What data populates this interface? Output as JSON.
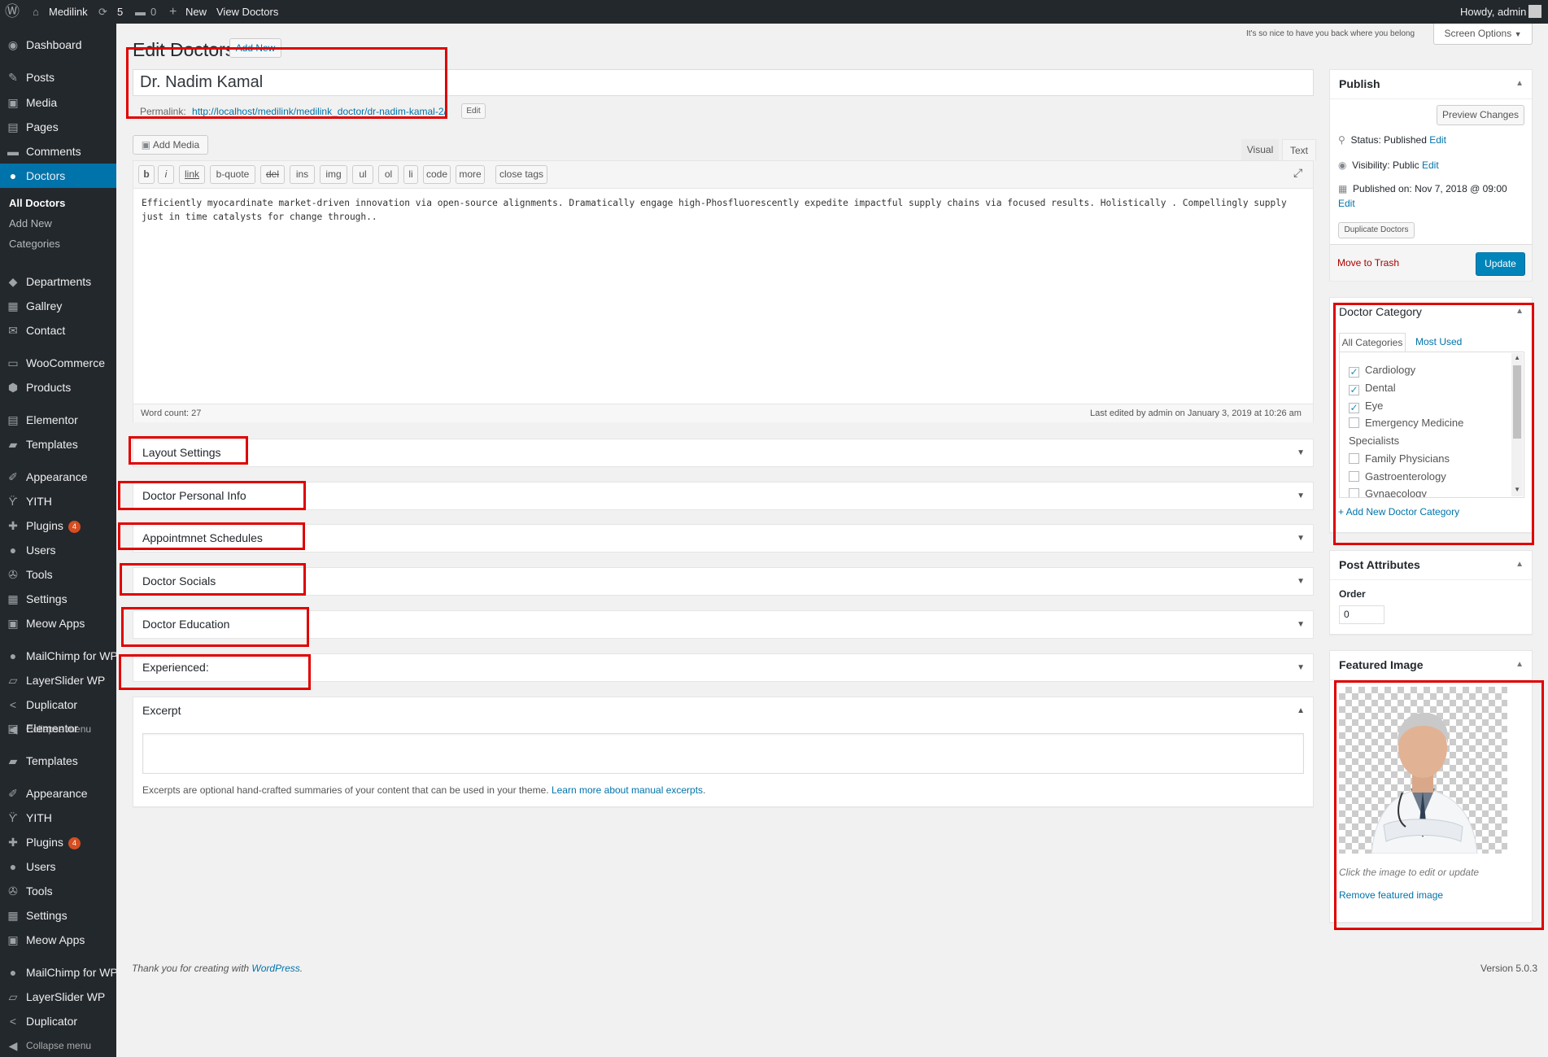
{
  "adminbar": {
    "site_name": "Medilink",
    "updates_count": "5",
    "comments_count": "0",
    "new_label": "New",
    "view_label": "View Doctors",
    "howdy": "Howdy, admin"
  },
  "sidebar": {
    "items": [
      {
        "label": "Dashboard",
        "icon": "dashboard-icon",
        "glyph": "◉"
      },
      {
        "label": "Posts",
        "icon": "pin-icon",
        "glyph": "✎"
      },
      {
        "label": "Media",
        "icon": "media-icon",
        "glyph": "▣"
      },
      {
        "label": "Pages",
        "icon": "page-icon",
        "glyph": "▤"
      },
      {
        "label": "Comments",
        "icon": "comment-icon",
        "glyph": "▬"
      },
      {
        "label": "Doctors",
        "icon": "user-icon",
        "glyph": "●"
      },
      {
        "label": "Departments",
        "icon": "tag-icon",
        "glyph": "◆"
      },
      {
        "label": "Gallrey",
        "icon": "gallery-icon",
        "glyph": "▦"
      },
      {
        "label": "Contact",
        "icon": "mail-icon",
        "glyph": "✉"
      },
      {
        "label": "WooCommerce",
        "icon": "woo-icon",
        "glyph": "▭"
      },
      {
        "label": "Products",
        "icon": "box-icon",
        "glyph": "⬢"
      },
      {
        "label": "Elementor",
        "icon": "elementor-icon",
        "glyph": "▤"
      },
      {
        "label": "Templates",
        "icon": "folder-icon",
        "glyph": "▰"
      },
      {
        "label": "Appearance",
        "icon": "brush-icon",
        "glyph": "✐"
      },
      {
        "label": "YITH",
        "icon": "yith-icon",
        "glyph": "ϔ"
      },
      {
        "label": "Plugins",
        "icon": "plugin-icon",
        "glyph": "✚",
        "badge": "4"
      },
      {
        "label": "Users",
        "icon": "users-icon",
        "glyph": "●"
      },
      {
        "label": "Tools",
        "icon": "wrench-icon",
        "glyph": "✇"
      },
      {
        "label": "Settings",
        "icon": "settings-icon",
        "glyph": "▦"
      },
      {
        "label": "Meow Apps",
        "icon": "camera-icon",
        "glyph": "▣"
      },
      {
        "label": "MailChimp for WP",
        "icon": "mailchimp-icon",
        "glyph": "●"
      },
      {
        "label": "LayerSlider WP",
        "icon": "layers-icon",
        "glyph": "▱"
      },
      {
        "label": "Duplicator",
        "icon": "share-icon",
        "glyph": "<"
      },
      {
        "label": "Collapse menu",
        "icon": "collapse-icon",
        "glyph": "◀"
      }
    ],
    "dup_items": [
      {
        "label": "Elementor",
        "icon": "elementor-icon",
        "glyph": "▤"
      },
      {
        "label": "Templates",
        "icon": "folder-icon",
        "glyph": "▰"
      },
      {
        "label": "Appearance",
        "icon": "brush-icon",
        "glyph": "✐"
      },
      {
        "label": "YITH",
        "icon": "yith-icon",
        "glyph": "ϔ"
      },
      {
        "label": "Plugins",
        "icon": "plugin-icon",
        "glyph": "✚",
        "badge": "4"
      },
      {
        "label": "Users",
        "icon": "users-icon",
        "glyph": "●"
      },
      {
        "label": "Tools",
        "icon": "wrench-icon",
        "glyph": "✇"
      },
      {
        "label": "Settings",
        "icon": "settings-icon",
        "glyph": "▦"
      },
      {
        "label": "Meow Apps",
        "icon": "camera-icon",
        "glyph": "▣"
      },
      {
        "label": "MailChimp for WP",
        "icon": "mailchimp-icon",
        "glyph": "●"
      },
      {
        "label": "LayerSlider WP",
        "icon": "layers-icon",
        "glyph": "▱"
      },
      {
        "label": "Duplicator",
        "icon": "share-icon",
        "glyph": "<"
      },
      {
        "label": "Collapse menu",
        "icon": "collapse-icon",
        "glyph": "◀"
      }
    ],
    "submenu": [
      "All Doctors",
      "Add New",
      "Categories"
    ]
  },
  "header": {
    "title": "Edit Doctors",
    "add_new": "Add New",
    "welcome": "It's so nice to have you back where you belong",
    "screen_options": "Screen Options"
  },
  "post": {
    "title": "Dr. Nadim Kamal",
    "permalink_label": "Permalink:",
    "permalink_url": "http://localhost/medilink/medilink_doctor/dr-nadim-kamal-2/",
    "edit_label": "Edit"
  },
  "editor": {
    "add_media": "Add Media",
    "tab_visual": "Visual",
    "tab_text": "Text",
    "quicktags": [
      "b",
      "i",
      "link",
      "b-quote",
      "del",
      "ins",
      "img",
      "ul",
      "ol",
      "li",
      "code",
      "more",
      "close tags"
    ],
    "content": "Efficiently myocardinate market-driven innovation via open-source alignments. Dramatically engage high-Phosfluorescently expedite impactful supply chains via focused results. Holistically . Compellingly supply just in time catalysts for change through..",
    "word_count": "Word count: 27",
    "last_edited": "Last edited by admin on January 3, 2019 at 10:26 am"
  },
  "metaboxes": [
    "Layout Settings",
    "Doctor Personal Info",
    "Appointmnet Schedules",
    "Doctor Socials",
    "Doctor Education",
    "Experienced:"
  ],
  "excerpt": {
    "title": "Excerpt",
    "help": "Excerpts are optional hand-crafted summaries of your content that can be used in your theme.",
    "link": "Learn more about manual excerpts"
  },
  "publish": {
    "title": "Publish",
    "preview": "Preview Changes",
    "status_label": "Status:",
    "status_value": "Published",
    "visibility_label": "Visibility:",
    "visibility_value": "Public",
    "published_on": "Published on: Nov 7, 2018 @ 09:00",
    "edit": "Edit",
    "duplicate": "Duplicate Doctors",
    "trash": "Move to Trash",
    "update": "Update"
  },
  "category": {
    "title": "Doctor Category",
    "tab_all": "All Categories",
    "tab_most": "Most Used",
    "items": [
      {
        "label": "Cardiology",
        "checked": true,
        "type": "checkbox"
      },
      {
        "label": "Dental",
        "checked": true,
        "type": "checkbox"
      },
      {
        "label": "Eye",
        "checked": true,
        "type": "checkbox"
      },
      {
        "label": "Emergency Medicine",
        "checked": false,
        "type": "checkbox"
      },
      {
        "label": "Specialists",
        "checked": false,
        "type": "heading"
      },
      {
        "label": "Family Physicians",
        "checked": false,
        "type": "checkbox"
      },
      {
        "label": "Gastroenterology",
        "checked": false,
        "type": "checkbox"
      },
      {
        "label": "Gynaecology",
        "checked": false,
        "type": "checkbox"
      }
    ],
    "add_new": "+ Add New Doctor Category"
  },
  "attributes": {
    "title": "Post Attributes",
    "order_label": "Order",
    "order_value": "0"
  },
  "featured": {
    "title": "Featured Image",
    "hint": "Click the image to edit or update",
    "remove": "Remove featured image"
  },
  "footer": {
    "thanks": "Thank you for creating with",
    "wp_link": "WordPress",
    "version": "Version 5.0.3"
  },
  "colors": {
    "accent": "#0073aa",
    "sidebar": "#23282d",
    "highlight": "#e00000"
  }
}
